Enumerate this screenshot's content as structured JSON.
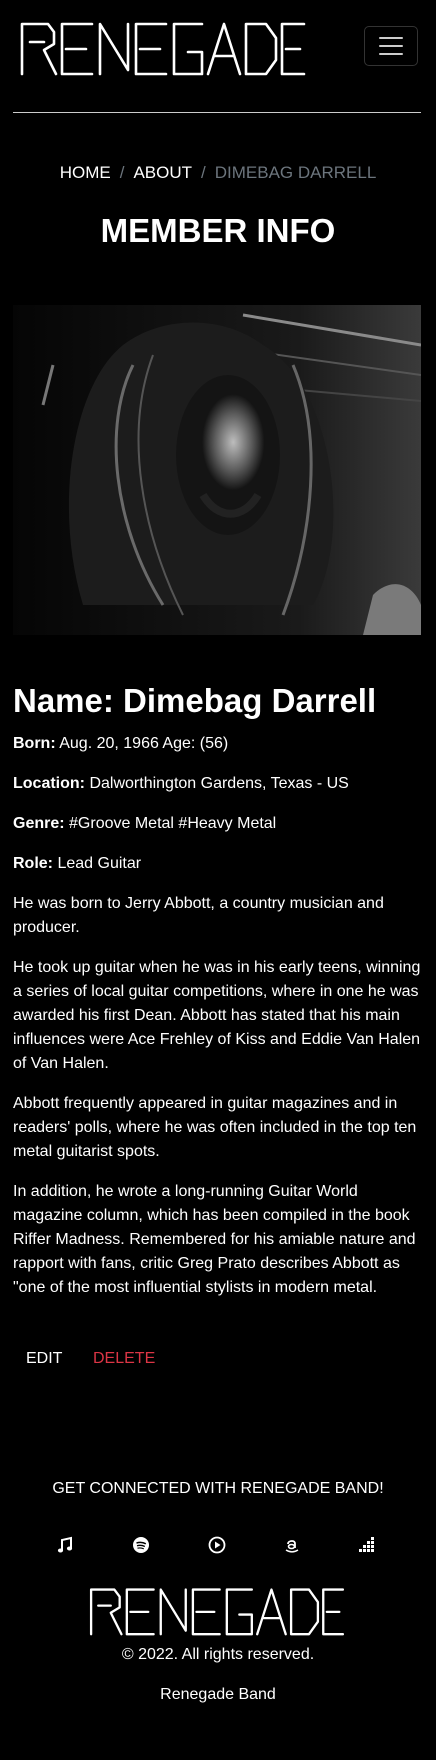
{
  "brand": {
    "logo_text": "RENEGADE"
  },
  "breadcrumb": {
    "home": "HOME",
    "about": "ABOUT",
    "current": "DIMEBAG DARRELL"
  },
  "page_title": "MEMBER INFO",
  "member": {
    "name": "Name: Dimebag Darrell",
    "born_label": "Born:",
    "born_value": "Aug. 20, 1966 Age: (56)",
    "location_label": "Location:",
    "location_value": "Dalworthington Gardens, Texas - US",
    "genre_label": "Genre:",
    "genre_value": "#Groove Metal #Heavy Metal",
    "role_label": "Role:",
    "role_value": "Lead Guitar",
    "bio": [
      "He was born to Jerry Abbott, a country musician and producer.",
      "He took up guitar when he was in his early teens, winning a series of local guitar competitions, where in one he was awarded his first Dean. Abbott has stated that his main influences were Ace Frehley of Kiss and Eddie Van Halen of Van Halen.",
      "Abbott frequently appeared in guitar magazines and in readers' polls, where he was often included in the top ten metal guitarist spots.",
      "In addition, he wrote a long-running Guitar World magazine column, which has been compiled in the book Riffer Madness. Remembered for his amiable nature and rapport with fans, critic Greg Prato describes Abbott as \"one of the most influential stylists in modern metal."
    ]
  },
  "actions": {
    "edit": "EDIT",
    "delete": "DELETE"
  },
  "footer": {
    "connect": "GET CONNECTED WITH RENEGADE BAND!",
    "social_icons": [
      "music-note-icon",
      "spotify-icon",
      "play-circle-icon",
      "amazon-icon",
      "deezer-icon"
    ],
    "copyright": "© 2022. All rights reserved.",
    "band_name": "Renegade Band"
  },
  "colors": {
    "background": "#000000",
    "text": "#ffffff",
    "muted": "#6c757d",
    "danger": "#dc3545"
  }
}
